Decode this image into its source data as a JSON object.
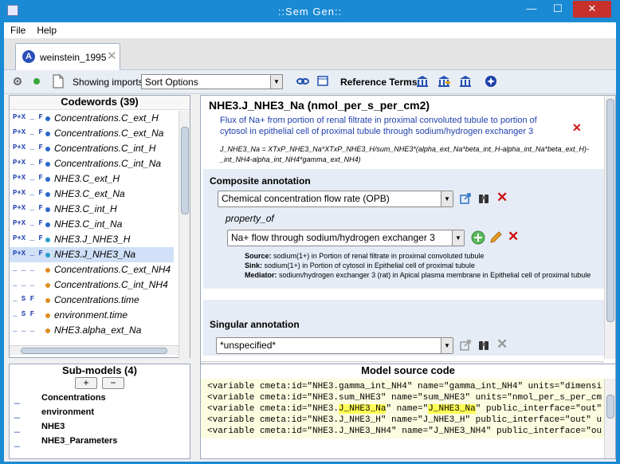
{
  "window": {
    "title": "::Sem Gen::",
    "min": "—",
    "max": "☐",
    "close": "✕"
  },
  "menu": {
    "file": "File",
    "help": "Help"
  },
  "tab": {
    "icon": "A",
    "label": "weinstein_1995",
    "close": "✕"
  },
  "toolbar": {
    "showing_imports": "Showing imports",
    "sort_options": "Sort Options",
    "reference_terms": "Reference Terms:"
  },
  "codewords": {
    "header": "Codewords (39)",
    "items": [
      {
        "flags": "P+X _ F",
        "name": "Concentrations.C_ext_H",
        "color": "#2a68c8"
      },
      {
        "flags": "P+X _ F",
        "name": "Concentrations.C_ext_Na",
        "color": "#2a68c8"
      },
      {
        "flags": "P+X _ F",
        "name": "Concentrations.C_int_H",
        "color": "#2a68c8"
      },
      {
        "flags": "P+X _ F",
        "name": "Concentrations.C_int_Na",
        "color": "#2a68c8"
      },
      {
        "flags": "P+X _ F",
        "name": "NHE3.C_ext_H",
        "color": "#2a68c8"
      },
      {
        "flags": "P+X _ F",
        "name": "NHE3.C_ext_Na",
        "color": "#2a68c8"
      },
      {
        "flags": "P+X _ F",
        "name": "NHE3.C_int_H",
        "color": "#2a68c8"
      },
      {
        "flags": "P+X _ F",
        "name": "NHE3.C_int_Na",
        "color": "#2a68c8"
      },
      {
        "flags": "P+X _ F",
        "name": "NHE3.J_NHE3_H",
        "color": "#2aa0c8"
      },
      {
        "flags": "P+X _ F",
        "name": "NHE3.J_NHE3_Na",
        "color": "#2aa0c8"
      },
      {
        "flags": "_ _ _",
        "name": "Concentrations.C_ext_NH4",
        "color": "#e08a20"
      },
      {
        "flags": "_ _ _",
        "name": "Concentrations.C_int_NH4",
        "color": "#e08a20"
      },
      {
        "flags": "_ S F",
        "name": "Concentrations.time",
        "color": "#e08a20"
      },
      {
        "flags": "_ S F",
        "name": "environment.time",
        "color": "#e08a20"
      },
      {
        "flags": "_ _ _",
        "name": "NHE3.alpha_ext_Na",
        "color": "#e08a20"
      }
    ]
  },
  "submodels": {
    "header": "Sub-models (4)",
    "add": "+",
    "remove": "−",
    "items": [
      {
        "mark": "_",
        "name": "Concentrations"
      },
      {
        "mark": "_",
        "name": "environment"
      },
      {
        "mark": "_",
        "name": "NHE3"
      },
      {
        "mark": "_",
        "name": "NHE3_Parameters"
      }
    ]
  },
  "detail": {
    "title": "NHE3.J_NHE3_Na (nmol_per_s_per_cm2)",
    "desc": "Flux of Na+ from portion of renal filtrate in proximal convoluted tubule to portion of cytosol in epithelial cell of proximal tubule through sodium/hydrogen exchanger 3",
    "eq": "J_NHE3_Na = XTxP_NHE3_Na*XTxP_NHE3_H/sum_NHE3*(alpha_ext_Na*beta_int_H-alpha_int_Na*beta_ext_H)-",
    "eq2": "_int_NH4-alpha_int_NH4*gamma_ext_NH4)",
    "composite_label": "Composite annotation",
    "composite_value": "Chemical concentration flow rate (OPB)",
    "property_of": "property_of",
    "process_value": "Na+ flow through sodium/hydrogen exchanger 3",
    "source_label": "Source:",
    "source_text": "sodium(1+) in Portion of renal filtrate in proximal convoluted tubule",
    "sink_label": "Sink:",
    "sink_text": "sodium(1+) in Portion of cytosol in Epithelial cell of proximal tubule",
    "mediator_label": "Mediator:",
    "mediator_text": "sodium/hydrogen exchanger 3 (rat) in Apical plasma membrane in Epithelial cell of proximal tubule",
    "singular_label": "Singular annotation",
    "singular_value": "*unspecified*"
  },
  "source": {
    "header": "Model source code",
    "lines": [
      "<variable cmeta:id=\"NHE3.gamma_int_NH4\" name=\"gamma_int_NH4\" units=\"dimensi",
      "<variable cmeta:id=\"NHE3.sum_NHE3\" name=\"sum_NHE3\" units=\"nmol_per_s_per_cm",
      "\" public_interface=\"out\" units=\"",
      "<variable cmeta:id=\"NHE3.J_NHE3_H\" name=\"J_NHE3_H\" public_interface=\"out\" u",
      "<variable cmeta:id=\"NHE3.J_NHE3_NH4\" name=\"J_NHE3_NH4\" public_interface=\"ou"
    ],
    "hl_pre": "<variable cmeta:id=\"NHE3.",
    "hl_a": "J_NHE3_Na",
    "hl_mid": "\" name=\"",
    "hl_b": "J_NHE3_Na"
  }
}
